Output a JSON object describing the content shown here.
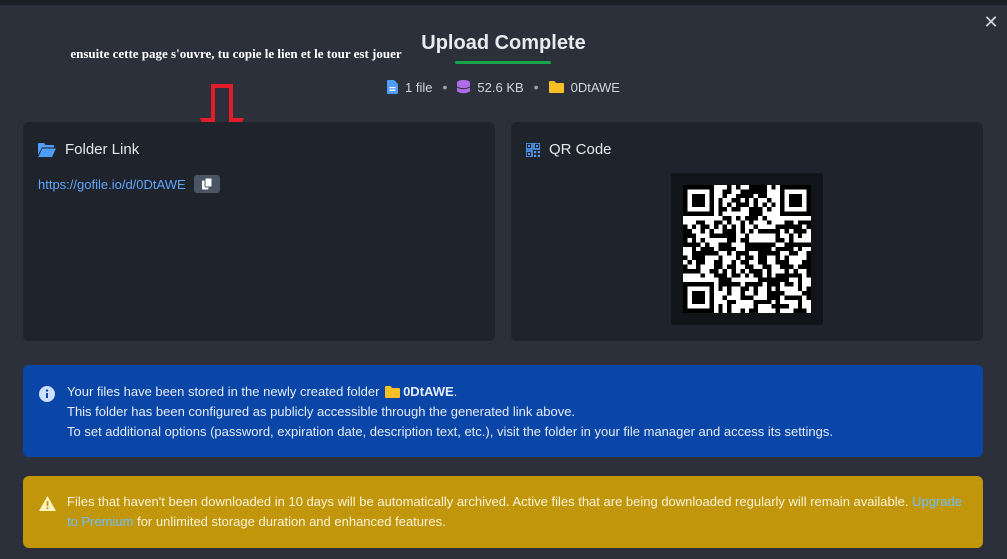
{
  "modal": {
    "title": "Upload Complete",
    "close_icon": "close-icon"
  },
  "annotation": {
    "text": "ensuite cette page s'ouvre, tu copie le lien et le tour est jouer",
    "arrow_color": "#e11d2a"
  },
  "meta": {
    "files": "1 file",
    "size": "52.6 KB",
    "folder": "0DtAWE",
    "icons": [
      "file-icon",
      "database-icon",
      "folder-icon"
    ]
  },
  "folder_link": {
    "title": "Folder Link",
    "url": "https://gofile.io/d/0DtAWE"
  },
  "qr": {
    "title": "QR Code"
  },
  "info_alert": {
    "line1_prefix": "Your files have been stored in the newly created folder",
    "folder_name": "0DtAWE",
    "line1_suffix": ".",
    "line2": "This folder has been configured as publicly accessible through the generated link above.",
    "line3": "To set additional options (password, expiration date, description text, etc.), visit the folder in your file manager and access its settings."
  },
  "warning_alert": {
    "text_before": "Files that haven't been downloaded in 10 days will be automatically archived. Active files that are being downloaded regularly will remain available.",
    "link": "Upgrade to Premium",
    "text_after": "for unlimited storage duration and enhanced features."
  },
  "colors": {
    "background": "#2b303a",
    "card": "#1e232c",
    "accent_green": "#16a34a",
    "link_blue": "#60a5fa",
    "info_bg": "#0a46a8",
    "warn_bg": "#c2960a"
  }
}
